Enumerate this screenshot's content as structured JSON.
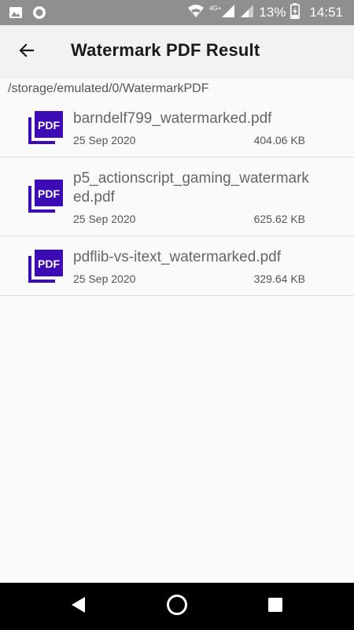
{
  "status_bar": {
    "network": "4G+",
    "battery": "13%",
    "time": "14:51"
  },
  "app_bar": {
    "title": "Watermark PDF Result"
  },
  "path": "/storage/emulated/0/WatermarkPDF",
  "icon_label": "PDF",
  "files": [
    {
      "name": "barndelf799_watermarked.pdf",
      "date": "25 Sep 2020",
      "size": "404.06 KB"
    },
    {
      "name": "p5_actionscript_gaming_watermarked.pdf",
      "date": "25 Sep 2020",
      "size": "625.62 KB"
    },
    {
      "name": "pdflib-vs-itext_watermarked.pdf",
      "date": "25 Sep 2020",
      "size": "329.64 KB"
    }
  ],
  "colors": {
    "pdf_icon": "#3d0bb3",
    "status_bar": "#8f8f8f",
    "app_bar": "#f2f2f2",
    "nav_bar": "#000000"
  },
  "icons": {
    "back": "arrow-left-icon",
    "gallery": "image-icon",
    "notification": "circle-icon",
    "wifi": "wifi-icon",
    "signal": "signal-icon",
    "battery": "battery-charging-icon",
    "pdf": "pdf-file-icon",
    "nav_back": "triangle-back-icon",
    "nav_home": "circle-home-icon",
    "nav_recents": "square-recents-icon"
  }
}
